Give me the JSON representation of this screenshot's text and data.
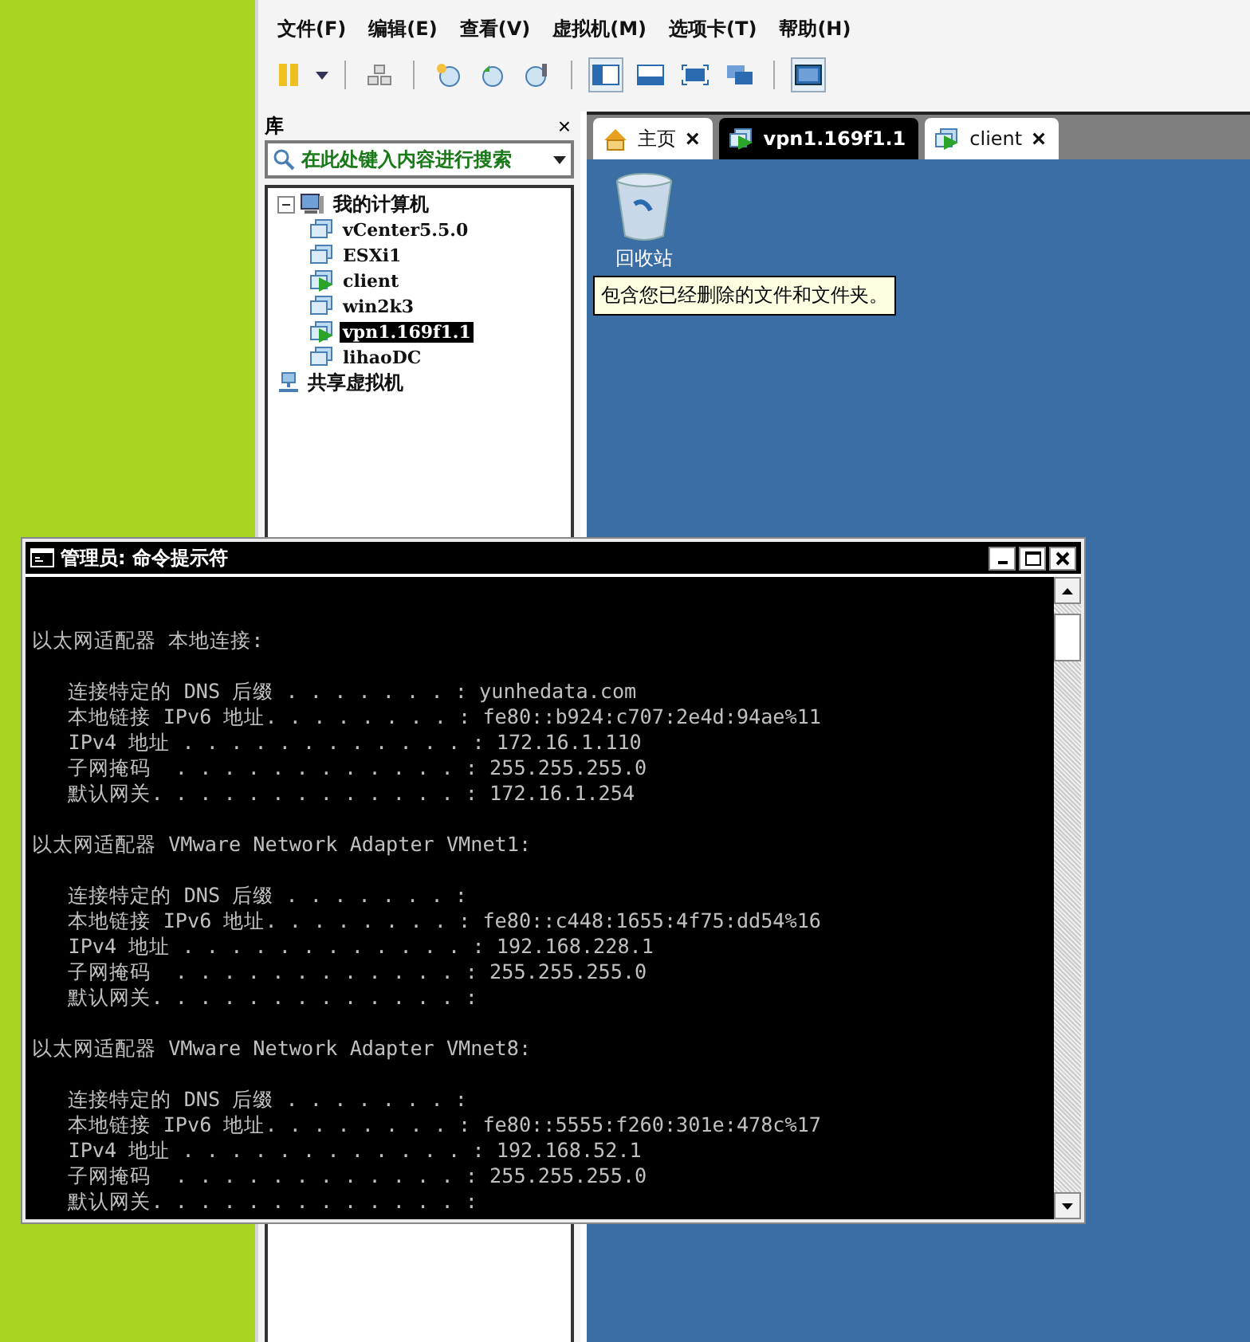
{
  "menu": [
    "文件(F)",
    "编辑(E)",
    "查看(V)",
    "虚拟机(M)",
    "选项卡(T)",
    "帮助(H)"
  ],
  "library": {
    "title": "库",
    "close": "×",
    "search": {
      "placeholder": "在此处键入内容进行搜索"
    },
    "tree": [
      {
        "label": "我的计算机",
        "kind": "computer",
        "expanded": true,
        "selected": false,
        "children": [
          {
            "label": "vCenter5.5.0",
            "kind": "vm",
            "running": false,
            "selected": false
          },
          {
            "label": "ESXi1",
            "kind": "vm",
            "running": false,
            "selected": false
          },
          {
            "label": "client",
            "kind": "vm",
            "running": true,
            "selected": false
          },
          {
            "label": "win2k3",
            "kind": "vm",
            "running": false,
            "selected": false
          },
          {
            "label": "vpn1.169f1.1",
            "kind": "vm",
            "running": true,
            "selected": true
          },
          {
            "label": "lihaoDC",
            "kind": "vm",
            "running": false,
            "selected": false
          }
        ]
      },
      {
        "label": "共享虚拟机",
        "kind": "shared",
        "selected": false
      }
    ]
  },
  "tabs": [
    {
      "label": "主页",
      "kind": "home",
      "selected": false,
      "close": "×"
    },
    {
      "label": "vpn1.169f1.1",
      "kind": "vm",
      "running": true,
      "selected": true
    },
    {
      "label": "client",
      "kind": "vm",
      "running": true,
      "selected": false,
      "close": "×"
    }
  ],
  "desktop": {
    "icon_label": "回收站",
    "tooltip": "包含您已经删除的文件和文件夹。"
  },
  "console": {
    "title": "管理员: 命令提示符",
    "sections": [
      {
        "heading": "以太网适配器 本地连接:",
        "lines": [
          "   连接特定的 DNS 后缀 . . . . . . . : yunhedata.com",
          "   本地链接 IPv6 地址. . . . . . . . : fe80::b924:c707:2e4d:94ae%11",
          "   IPv4 地址 . . . . . . . . . . . . : 172.16.1.110",
          "   子网掩码  . . . . . . . . . . . . : 255.255.255.0",
          "   默认网关. . . . . . . . . . . . . : 172.16.1.254"
        ]
      },
      {
        "heading": "以太网适配器 VMware Network Adapter VMnet1:",
        "lines": [
          "   连接特定的 DNS 后缀 . . . . . . . :",
          "   本地链接 IPv6 地址. . . . . . . . : fe80::c448:1655:4f75:dd54%16",
          "   IPv4 地址 . . . . . . . . . . . . : 192.168.228.1",
          "   子网掩码  . . . . . . . . . . . . : 255.255.255.0",
          "   默认网关. . . . . . . . . . . . . :"
        ]
      },
      {
        "heading": "以太网适配器 VMware Network Adapter VMnet8:",
        "lines": [
          "   连接特定的 DNS 后缀 . . . . . . . :",
          "   本地链接 IPv6 地址. . . . . . . . : fe80::5555:f260:301e:478c%17",
          "   IPv4 地址 . . . . . . . . . . . . : 192.168.52.1",
          "   子网掩码  . . . . . . . . . . . . : 255.255.255.0",
          "   默认网关. . . . . . . . . . . . . :"
        ]
      }
    ]
  }
}
